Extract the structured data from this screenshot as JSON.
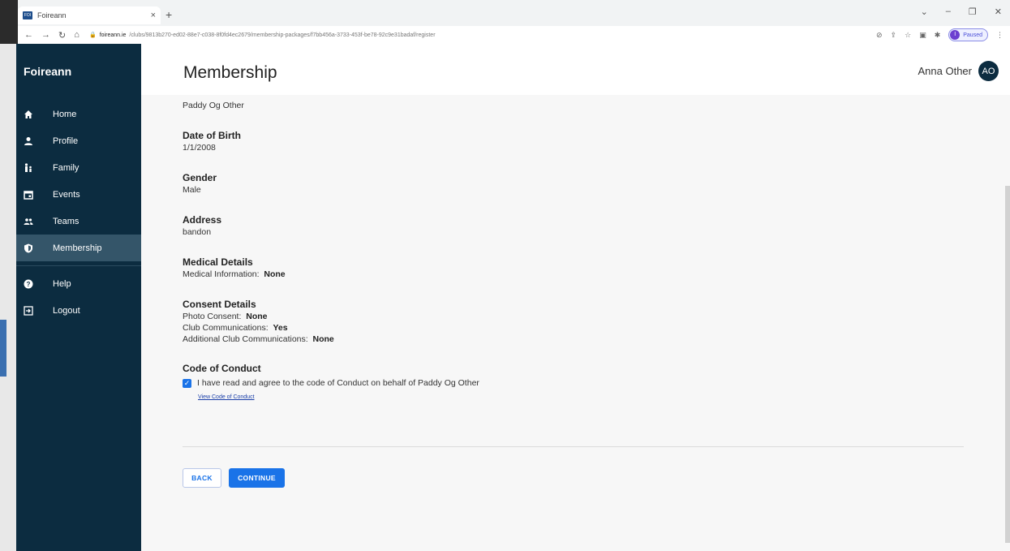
{
  "browser": {
    "tab_title": "Foireann",
    "tab_favicon_text": "FOI",
    "tab_close": "×",
    "new_tab": "+",
    "url_host": "foireann.ie",
    "url_path": "/clubs/9813b270-ed02-88e7-c038-8f0fd4ec2679/membership-packages/f7bb456a-3733-453f-be78-92c9e31badaf/register",
    "profile_state": "Paused",
    "profile_initial": "I"
  },
  "sidebar": {
    "brand": "Foireann",
    "items": [
      {
        "label": "Home",
        "icon": "home-icon"
      },
      {
        "label": "Profile",
        "icon": "person-icon"
      },
      {
        "label": "Family",
        "icon": "family-icon"
      },
      {
        "label": "Events",
        "icon": "calendar-icon"
      },
      {
        "label": "Teams",
        "icon": "group-icon"
      },
      {
        "label": "Membership",
        "icon": "shield-icon",
        "active": true
      },
      {
        "label": "Help",
        "icon": "help-icon"
      },
      {
        "label": "Logout",
        "icon": "logout-icon"
      }
    ]
  },
  "header": {
    "title": "Membership",
    "user_name": "Anna Other",
    "user_initials": "AO"
  },
  "details": {
    "name": "Paddy Og Other",
    "dob_title": "Date of Birth",
    "dob": "1/1/2008",
    "gender_title": "Gender",
    "gender": "Male",
    "address_title": "Address",
    "address": "bandon",
    "medical_title": "Medical Details",
    "medical_label": "Medical Information:",
    "medical_value": "None",
    "consent_title": "Consent Details",
    "photo_label": "Photo Consent:",
    "photo_value": "None",
    "club_comm_label": "Club Communications:",
    "club_comm_value": "Yes",
    "add_comm_label": "Additional Club Communications:",
    "add_comm_value": "None",
    "coc_title": "Code of Conduct",
    "coc_agree": "I have read and agree to the code of Conduct on behalf of Paddy Og Other",
    "coc_checked": true,
    "coc_link": "View Code of Conduct"
  },
  "actions": {
    "back": "BACK",
    "continue": "CONTINUE"
  },
  "colors": {
    "sidebar_bg": "#0c2c40",
    "sidebar_active": "#345569",
    "primary": "#1a73e8"
  }
}
